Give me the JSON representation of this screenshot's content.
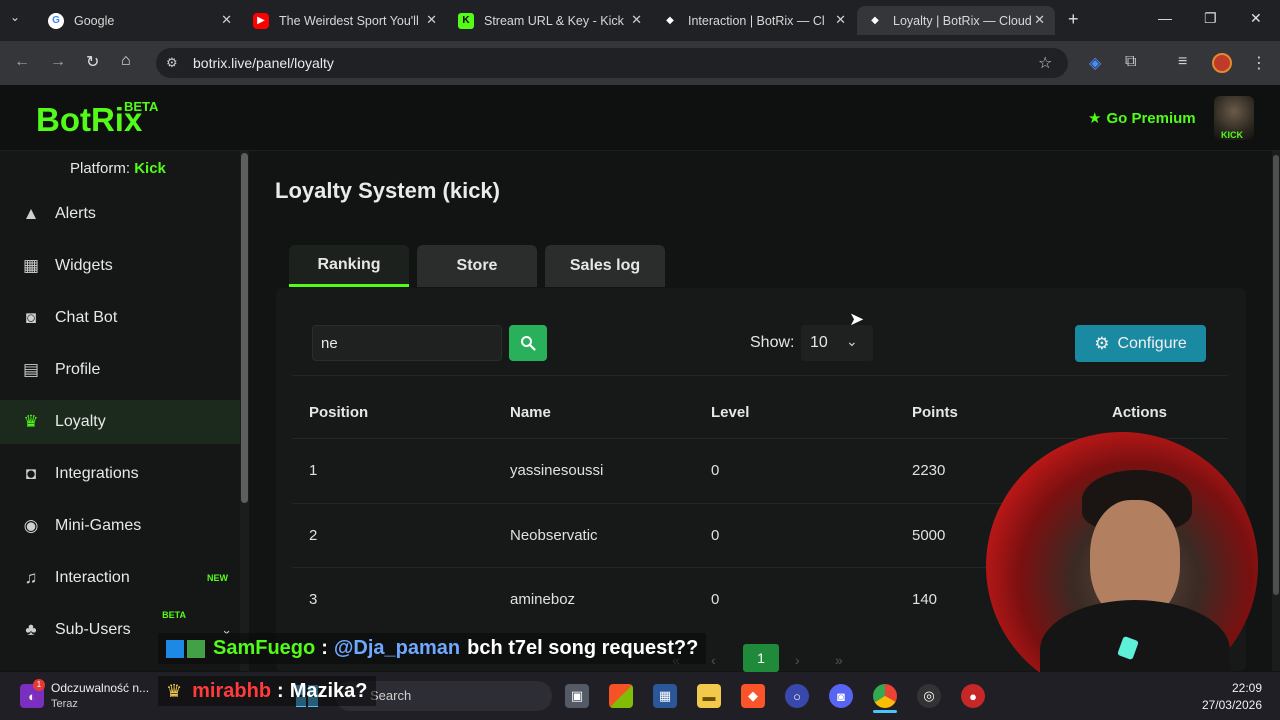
{
  "browser": {
    "tabs": [
      {
        "title": "Google",
        "favicon": "google-icon",
        "color": "#4285f4"
      },
      {
        "title": "The Weirdest Sport You'll",
        "favicon": "youtube-icon",
        "color": "#ff0000"
      },
      {
        "title": "Stream URL & Key - Kick",
        "favicon": "kick-icon",
        "color": "#53fc18"
      },
      {
        "title": "Interaction | BotRix — Cl",
        "favicon": "botrix-icon",
        "color": "#ffffff"
      },
      {
        "title": "Loyalty | BotRix — Cloud",
        "favicon": "botrix-icon",
        "color": "#ffffff"
      }
    ],
    "url": "botrix.live/panel/loyalty"
  },
  "app": {
    "logo": "BotRix",
    "logo_badge": "BETA",
    "go_premium": "Go Premium",
    "avatar_tag": "KICK",
    "accent": "#53fc18"
  },
  "sidebar": {
    "platform_label": "Platform:",
    "platform_value": "Kick",
    "items": [
      {
        "label": "Alerts",
        "icon": "warning-icon",
        "badge": ""
      },
      {
        "label": "Widgets",
        "icon": "grid-icon",
        "badge": ""
      },
      {
        "label": "Chat Bot",
        "icon": "robot-icon",
        "badge": ""
      },
      {
        "label": "Profile",
        "icon": "id-card-icon",
        "badge": ""
      },
      {
        "label": "Loyalty",
        "icon": "trophy-icon",
        "badge": ""
      },
      {
        "label": "Integrations",
        "icon": "discord-icon",
        "badge": ""
      },
      {
        "label": "Mini-Games",
        "icon": "gamepad-icon",
        "badge": ""
      },
      {
        "label": "Interaction",
        "icon": "music-icon",
        "badge": "NEW"
      },
      {
        "label": "Sub-Users",
        "icon": "users-icon",
        "badge": "BETA"
      }
    ]
  },
  "main": {
    "title": "Loyalty System (kick)",
    "tabs": [
      "Ranking",
      "Store",
      "Sales log"
    ],
    "search_value": "ne",
    "show_label": "Show:",
    "show_value": "10",
    "configure_label": "Configure",
    "columns": [
      "Position",
      "Name",
      "Level",
      "Points",
      "Actions"
    ],
    "rows": [
      {
        "position": "1",
        "name": "yassinesoussi",
        "level": "0",
        "points": "2230"
      },
      {
        "position": "2",
        "name": "Neobservatic",
        "level": "0",
        "points": "5000"
      },
      {
        "position": "3",
        "name": "amineboz",
        "level": "0",
        "points": "140"
      }
    ],
    "current_page": "1"
  },
  "overlay": {
    "chat": [
      {
        "user": "SamFuego",
        "mention": "@Dja_paman",
        "message": "bch t7el song request??",
        "user_color": "#53fc18",
        "mention_color": "#6fa8ff"
      },
      {
        "user": "mirabhb",
        "mention": "",
        "message": "Mazika?",
        "user_color": "#ff3b3b",
        "mention_color": ""
      }
    ]
  },
  "taskbar": {
    "notification_title": "Odczuwalność n...",
    "notification_sub": "Teraz",
    "search_placeholder": "Search",
    "time": "22:09",
    "date": "27/03/2026"
  }
}
